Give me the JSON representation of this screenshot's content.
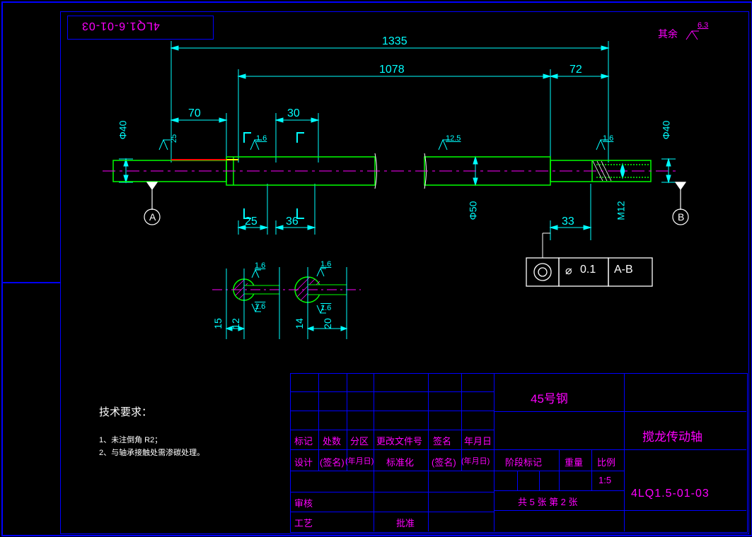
{
  "drawing_number_reversed": "4LQ1.6-01-03",
  "surface_note": "其余",
  "surface_val": "6.3",
  "dims": {
    "d1335": "1335",
    "d1078": "1078",
    "d72": "72",
    "d70": "70",
    "d30": "30",
    "phi40L": "Φ40",
    "phi40R": "Φ40",
    "sf25": "25",
    "sf16a": "1.6",
    "sf16b": "1.6",
    "sf125": "12.5",
    "phi50": "Φ50",
    "m12": "M12",
    "d25": "25",
    "d36": "36",
    "d33": "33",
    "sec15": "15",
    "sec12": "12",
    "sec20": "20",
    "sec14": "14",
    "sec16a": "1.6",
    "sec16b": "1.6",
    "sec16c": "1.6",
    "sec16d": "1.6"
  },
  "datums": {
    "A": "A",
    "B": "B"
  },
  "fcf": {
    "tol": "0.1",
    "ref": "A-B"
  },
  "tech_req": {
    "title": "技术要求：",
    "line1": "1、未注倒角 R2；",
    "line2": "2、与轴承接触处需渗碳处理。"
  },
  "titleblock": {
    "material": "45号钢",
    "part_name": "搅龙传动轴",
    "drawing_no": "4LQ1.5-01-03",
    "mark": "标记",
    "qty": "处数",
    "zone": "分区",
    "doc": "更改文件号",
    "sign": "签名",
    "date": "年月日",
    "design": "设计",
    "sign2": "(签名)",
    "date2": "(年月日)",
    "std": "标准化",
    "sign3": "(签名)",
    "date3": "(年月日)",
    "check": "审核",
    "approve": "批准",
    "process": "工艺",
    "stage": "阶段标记",
    "mass": "重量",
    "scale": "比例",
    "scale_val": "1:5",
    "sheets": "共 5 张 第 2 张"
  }
}
